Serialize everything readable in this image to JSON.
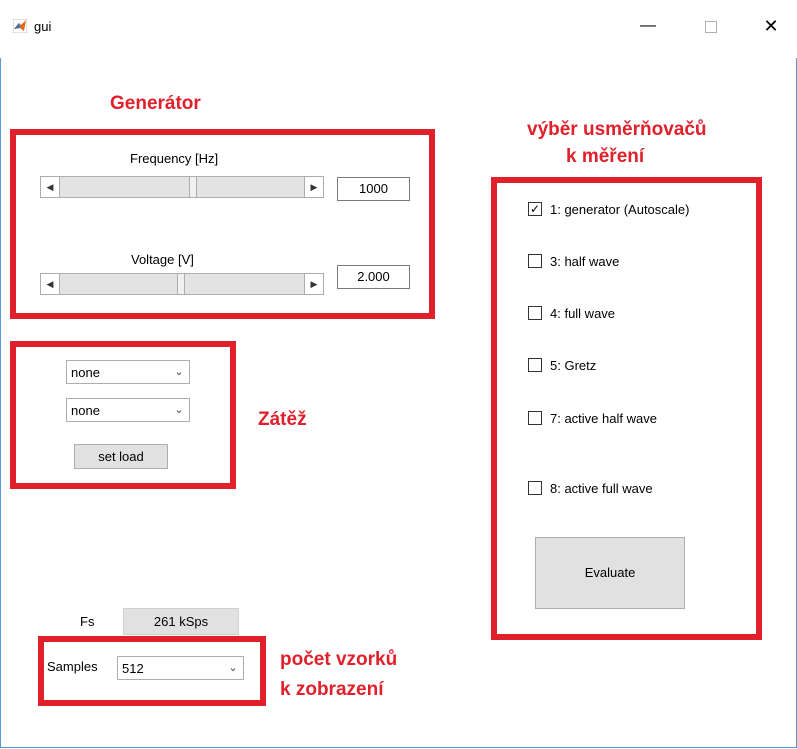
{
  "window": {
    "title": "gui",
    "minimize_glyph": "—",
    "close_glyph": "✕"
  },
  "annotations": {
    "generator": "Generátor",
    "load": "Zátěž",
    "rectifier_selection_line1": "výběr usměrňovačů",
    "rectifier_selection_line2": "k měření",
    "samples_note_line1": "počet vzorků",
    "samples_note_line2": "k zobrazení",
    "color": "#e0202a"
  },
  "generator": {
    "frequency_label": "Frequency [Hz]",
    "frequency_value": "1000",
    "voltage_label": "Voltage [V]",
    "voltage_value": "2.000"
  },
  "load": {
    "dropdown1_value": "none",
    "dropdown2_value": "none",
    "set_load_label": "set load"
  },
  "rectifiers": {
    "items": [
      {
        "label": "1: generator (Autoscale)",
        "checked": true
      },
      {
        "label": "3: half wave",
        "checked": false
      },
      {
        "label": "4: full wave",
        "checked": false
      },
      {
        "label": "5: Gretz",
        "checked": false
      },
      {
        "label": "7: active half wave",
        "checked": false
      },
      {
        "label": "8: active full wave",
        "checked": false
      }
    ],
    "evaluate_label": "Evaluate"
  },
  "sampling": {
    "fs_label": "Fs",
    "fs_value": "261 kSps",
    "samples_label": "Samples",
    "samples_value": "512"
  },
  "icons": {
    "app": "matlab-icon",
    "chevron": "chevron-down-icon",
    "arrow_left": "◀",
    "arrow_right": "▶",
    "check": "✓"
  }
}
